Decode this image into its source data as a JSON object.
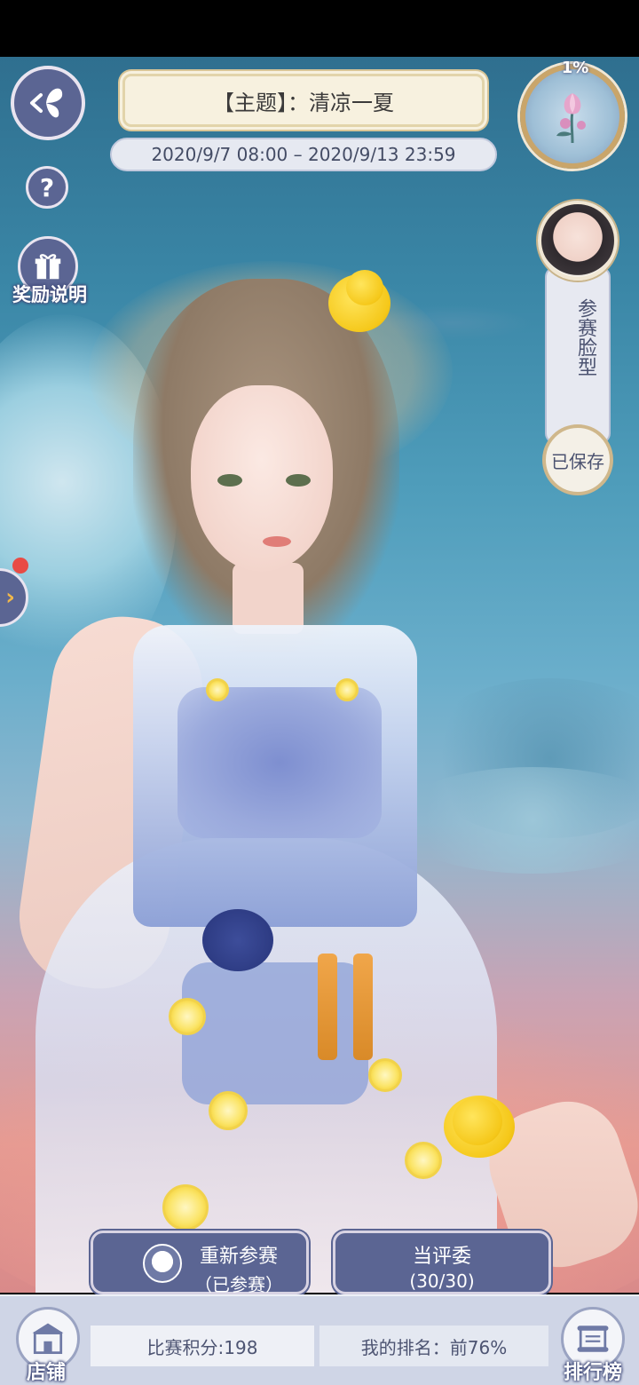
{
  "header": {
    "theme_title": "【主题】：清凉一夏",
    "date_range": "2020/9/7 08:00 – 2020/9/13 23:59",
    "progress_percent": "1%"
  },
  "left_controls": {
    "help_label": "?",
    "reward_label": "奖励说明"
  },
  "face_panel": {
    "label": "参赛脸型",
    "saved_label": "已保存"
  },
  "actions": {
    "rejoin": {
      "line1": "重新参赛",
      "line2": "（已参赛）"
    },
    "judge": {
      "line1": "当评委",
      "line2": "(30/30)"
    }
  },
  "bottom_bar": {
    "score": "比赛积分:198",
    "rank": "我的排名：前76%",
    "shop_label": "店铺",
    "leaderboard_label": "排行榜"
  },
  "colors": {
    "button_bg": "#5b6593",
    "banner_bg": "#f7f1df",
    "accent_gold": "#c9a56a"
  },
  "icons": [
    "butterfly-back-icon",
    "help-icon",
    "gift-icon",
    "flower-icon",
    "chevron-right-icon",
    "shop-icon",
    "scroll-icon"
  ]
}
